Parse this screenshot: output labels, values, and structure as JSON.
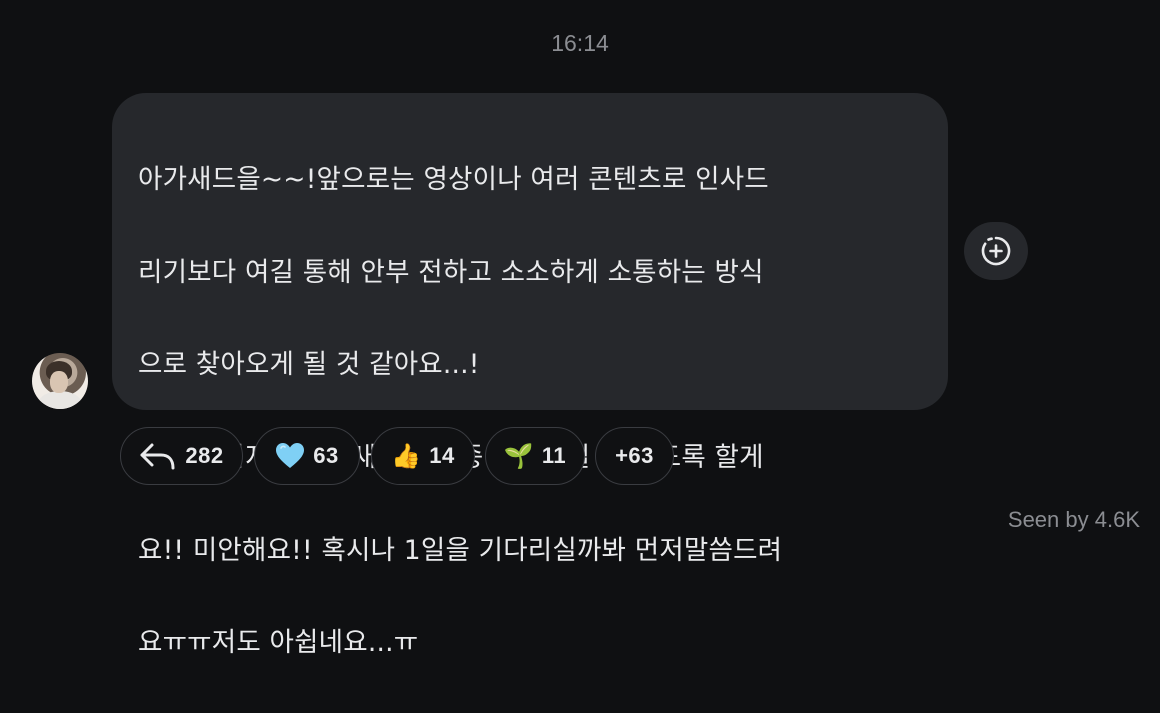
{
  "chat": {
    "timestamp": "16:14",
    "message": {
      "lines": [
        "아가새드을~~!앞으로는 영상이나 여러 콘텐츠로 인사드",
        "리기보다 여길 통해 안부 전하고 소소하게 소통하는 방식",
        "으로 찾아오게 될 것 같아요...!",
        "조금 아쉽지만 아가새한테 종종 인사드릴 수 있도록 할게",
        "요!! 미안해요!! 혹시나 1일을 기다리실까봐 먼저말씀드려",
        "요ㅠㅠ저도 아쉽네요...ㅠ"
      ]
    },
    "add_reaction_icon": "add-reaction-icon",
    "reactions": [
      {
        "icon": "reply-arrow-icon",
        "label": "",
        "count": "282"
      },
      {
        "icon": "light-blue-heart-icon",
        "label": "🩵",
        "count": "63"
      },
      {
        "icon": "thumbs-up-icon",
        "label": "👍",
        "count": "14"
      },
      {
        "icon": "seedling-icon",
        "label": "🌱",
        "count": "11"
      },
      {
        "icon": "",
        "label": "",
        "count": "+63"
      }
    ],
    "seen_by": "Seen by 4.6K"
  },
  "colors": {
    "background": "#0f1012",
    "bubble": "#26282c",
    "text": "#e9eaec",
    "muted": "#8b8d92"
  }
}
